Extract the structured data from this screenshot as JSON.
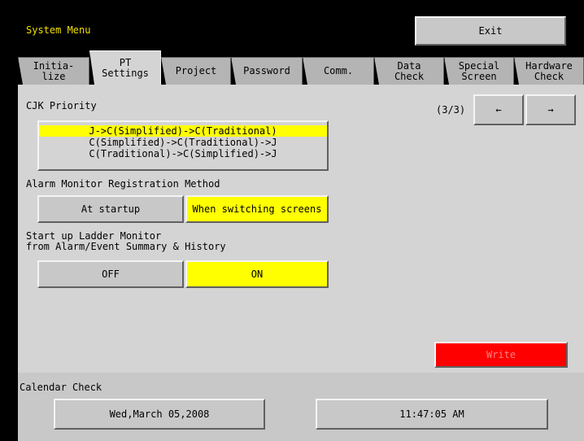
{
  "header": {
    "title": "System Menu",
    "exit_label": "Exit"
  },
  "tabs": [
    {
      "label": "Initia-\nlize",
      "active": false
    },
    {
      "label": "PT\nSettings",
      "active": true
    },
    {
      "label": "Project",
      "active": false
    },
    {
      "label": "Password",
      "active": false
    },
    {
      "label": "Comm.",
      "active": false
    },
    {
      "label": "Data\nCheck",
      "active": false
    },
    {
      "label": "Special\nScreen",
      "active": false
    },
    {
      "label": "Hardware\nCheck",
      "active": false
    }
  ],
  "settings": {
    "cjk_priority": {
      "label": "CJK Priority",
      "options": [
        "J->C(Simplified)->C(Traditional)",
        "C(Simplified)->C(Traditional)->J",
        "C(Traditional)->C(Simplified)->J"
      ],
      "selected_index": 0
    },
    "alarm_monitor": {
      "label": "Alarm Monitor Registration Method",
      "options": [
        "At startup",
        "When switching screens"
      ],
      "selected": "When switching screens"
    },
    "ladder_monitor": {
      "label": "Start up Ladder Monitor\nfrom Alarm/Event Summary & History",
      "options": [
        "OFF",
        "ON"
      ],
      "selected": "ON"
    },
    "pagination": {
      "indicator": "(3/3)",
      "prev_label": "←",
      "next_label": "→"
    },
    "write_label": "Write"
  },
  "calendar": {
    "label": "Calendar Check",
    "date": "Wed,March 05,2008",
    "time": "11:47:05 AM"
  },
  "colors": {
    "selected": "#ffff00",
    "write": "#ff0000",
    "title": "#f0e000",
    "panel": "#d4d4d4"
  }
}
